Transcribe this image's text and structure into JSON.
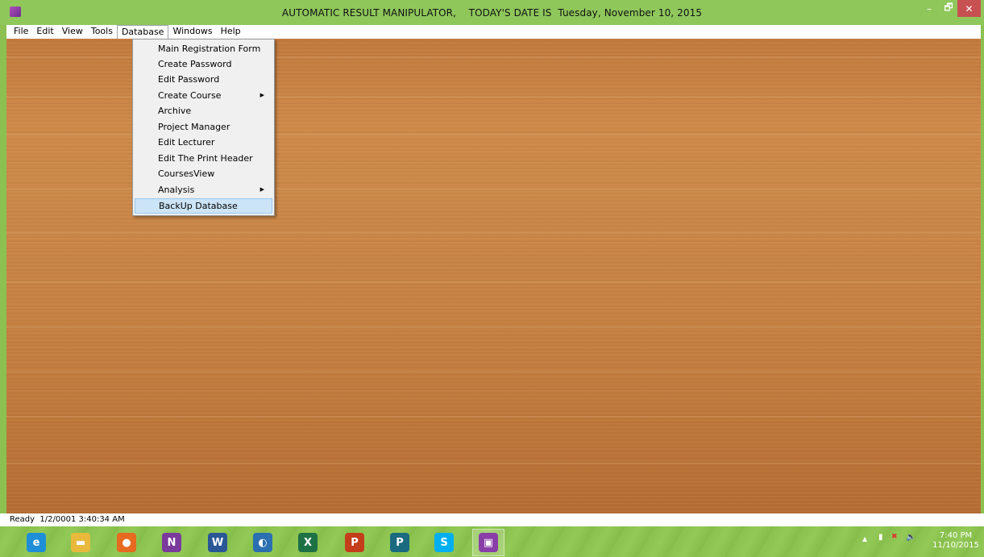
{
  "window": {
    "title": "AUTOMATIC RESULT MANIPULATOR,    TODAY'S DATE IS  Tuesday, November 10, 2015",
    "controls": {
      "minimize": "–",
      "maximize": "🗗",
      "close": "✕"
    }
  },
  "menubar": {
    "items": [
      "File",
      "Edit",
      "View",
      "Tools",
      "Database",
      "Windows",
      "Help"
    ],
    "active": "Database"
  },
  "database_menu": {
    "items": [
      {
        "label": "Main Registration Form"
      },
      {
        "label": "Create Password"
      },
      {
        "label": "Edit Password"
      },
      {
        "label": "Create Course",
        "submenu_arrow": "▶"
      },
      {
        "label": "Archive"
      },
      {
        "label": "Project Manager"
      },
      {
        "label": "Edit Lecturer"
      },
      {
        "label": "Edit The Print Header"
      },
      {
        "label": "CoursesView"
      },
      {
        "label": "Analysis",
        "submenu_arrow": "▶"
      },
      {
        "label": "BackUp Database"
      }
    ],
    "highlighted": "BackUp Database"
  },
  "statusbar": {
    "text": "Ready  1/2/0001 3:40:34 AM"
  },
  "taskbar": {
    "apps": [
      {
        "name": "internet-explorer-icon",
        "glyph": "e",
        "color": "#1e8fd6"
      },
      {
        "name": "file-explorer-icon",
        "glyph": "▬",
        "color": "#e8b93c"
      },
      {
        "name": "firefox-icon",
        "glyph": "●",
        "color": "#e66a1f"
      },
      {
        "name": "onenote-icon",
        "glyph": "N",
        "color": "#7a3b9c"
      },
      {
        "name": "word-icon",
        "glyph": "W",
        "color": "#2b5797"
      },
      {
        "name": "edge-app-icon",
        "glyph": "◐",
        "color": "#2a6fb0"
      },
      {
        "name": "excel-icon",
        "glyph": "X",
        "color": "#1e7145"
      },
      {
        "name": "powerpoint-icon",
        "glyph": "P",
        "color": "#c43e1c"
      },
      {
        "name": "publisher-icon",
        "glyph": "P",
        "color": "#1a6a80"
      },
      {
        "name": "skype-icon",
        "glyph": "S",
        "color": "#00aff0"
      },
      {
        "name": "result-manipulator-app-icon",
        "glyph": "▣",
        "color": "#8a3ea8"
      }
    ],
    "tray": {
      "up_arrow": "▲",
      "battery": "▮",
      "network": "✖",
      "volume": "🔈"
    },
    "clock": {
      "time": "7:40 PM",
      "date": "11/10/2015"
    }
  }
}
